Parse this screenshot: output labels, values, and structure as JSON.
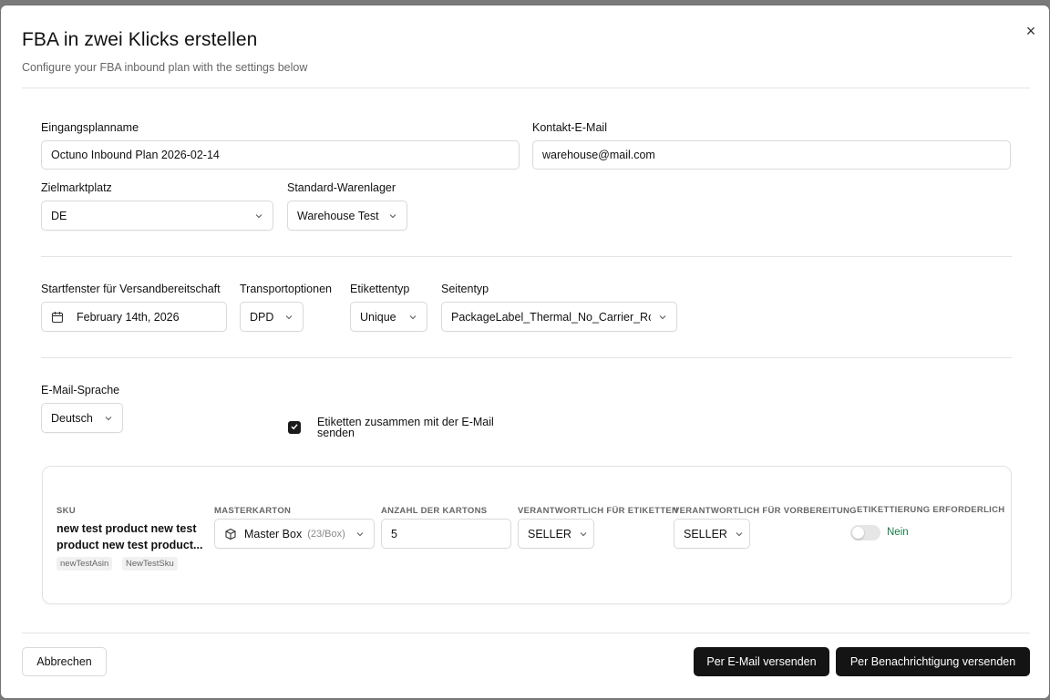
{
  "dialog": {
    "title": "FBA in zwei Klicks erstellen",
    "subtitle": "Configure your FBA inbound plan with the settings below",
    "close_glyph": "×"
  },
  "plan_name": {
    "label": "Eingangsplanname",
    "value": "Octuno Inbound Plan 2026-02-14"
  },
  "contact_email": {
    "label": "Kontakt-E-Mail",
    "value": "warehouse@mail.com"
  },
  "marketplace": {
    "label": "Zielmarktplatz",
    "value": "DE"
  },
  "warehouse": {
    "label": "Standard-Warenlager",
    "value": "Warehouse Test"
  },
  "ready_window": {
    "label": "Startfenster für Versandbereitschaft",
    "value": "February 14th, 2026"
  },
  "transport": {
    "label": "Transportoptionen",
    "value": "DPD"
  },
  "label_type": {
    "label": "Etikettentyp",
    "value": "Unique"
  },
  "page_type": {
    "label": "Seitentyp",
    "value": "PackageLabel_Thermal_No_Carrier_Rot"
  },
  "email_language": {
    "label": "E-Mail-Sprache",
    "value": "Deutsch"
  },
  "send_labels": {
    "label": "Etiketten zusammen mit der E-Mail senden",
    "checked": true
  },
  "sku_table": {
    "headers": {
      "sku": "SKU",
      "master_carton": "MASTERKARTON",
      "carton_count": "ANZAHL DER KARTONS",
      "label_owner": "VERANTWORTLICH FÜR ETIKETTEN",
      "prep_owner": "VERANTWORTLICH FÜR VORBEREITUNG",
      "labeling_required": "ETIKETTIERUNG ERFORDERLICH"
    },
    "row": {
      "sku_name": "new test product new test product new test product...",
      "tags": [
        "newTestAsin",
        "NewTestSku"
      ],
      "master_carton": "Master Box",
      "master_carton_capacity": "(23/Box)",
      "carton_count": "5",
      "label_owner": "SELLER",
      "prep_owner": "SELLER",
      "labeling_required": "Nein",
      "labeling_required_on": false
    }
  },
  "footer": {
    "cancel": "Abbrechen",
    "send_email": "Per E-Mail versenden",
    "send_notification": "Per Benachrichtigung versenden"
  },
  "colors": {
    "primary": "#141414",
    "success": "#1a7a4a",
    "border": "#d9d9d9"
  },
  "icons": [
    "close-icon",
    "chevron-down-icon",
    "calendar-icon",
    "box-icon",
    "check-icon"
  ]
}
